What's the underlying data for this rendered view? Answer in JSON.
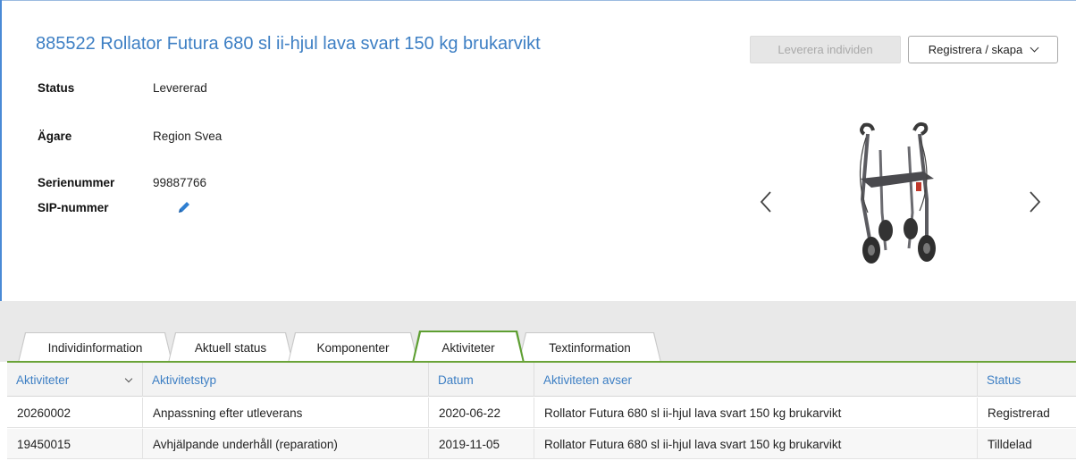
{
  "header": {
    "title": "885522 Rollator Futura 680 sl ii-hjul lava svart 150 kg brukarvikt",
    "deliver_button": "Leverera individen",
    "register_button": "Registrera / skapa"
  },
  "fields": {
    "status_label": "Status",
    "status_value": "Levererad",
    "owner_label": "Ägare",
    "owner_value": "Region Svea",
    "serial_label": "Serienummer",
    "serial_value": "99887766",
    "sip_label": "SIP-nummer"
  },
  "carousel": {
    "prev_icon": "chevron-left-icon",
    "next_icon": "chevron-right-icon",
    "image": "rollator-product-image"
  },
  "tabs": [
    {
      "label": "Individinformation",
      "active": false
    },
    {
      "label": "Aktuell status",
      "active": false
    },
    {
      "label": "Komponenter",
      "active": false
    },
    {
      "label": "Aktiviteter",
      "active": true
    },
    {
      "label": "Textinformation",
      "active": false
    }
  ],
  "table": {
    "columns": [
      "Aktiviteter",
      "Aktivitetstyp",
      "Datum",
      "Aktiviteten avser",
      "Status"
    ],
    "rows": [
      [
        "20260002",
        "Anpassning efter utleverans",
        "2020-06-22",
        "Rollator Futura 680 sl ii-hjul lava svart 150 kg brukarvikt",
        "Registrerad"
      ],
      [
        "19450015",
        "Avhjälpande underhåll (reparation)",
        "2019-11-05",
        "Rollator Futura 680 sl ii-hjul lava svart 150 kg brukarvikt",
        "Tilldelad"
      ]
    ]
  },
  "colors": {
    "accent_blue": "#3d7fc4",
    "active_tab_green": "#6aa338"
  }
}
